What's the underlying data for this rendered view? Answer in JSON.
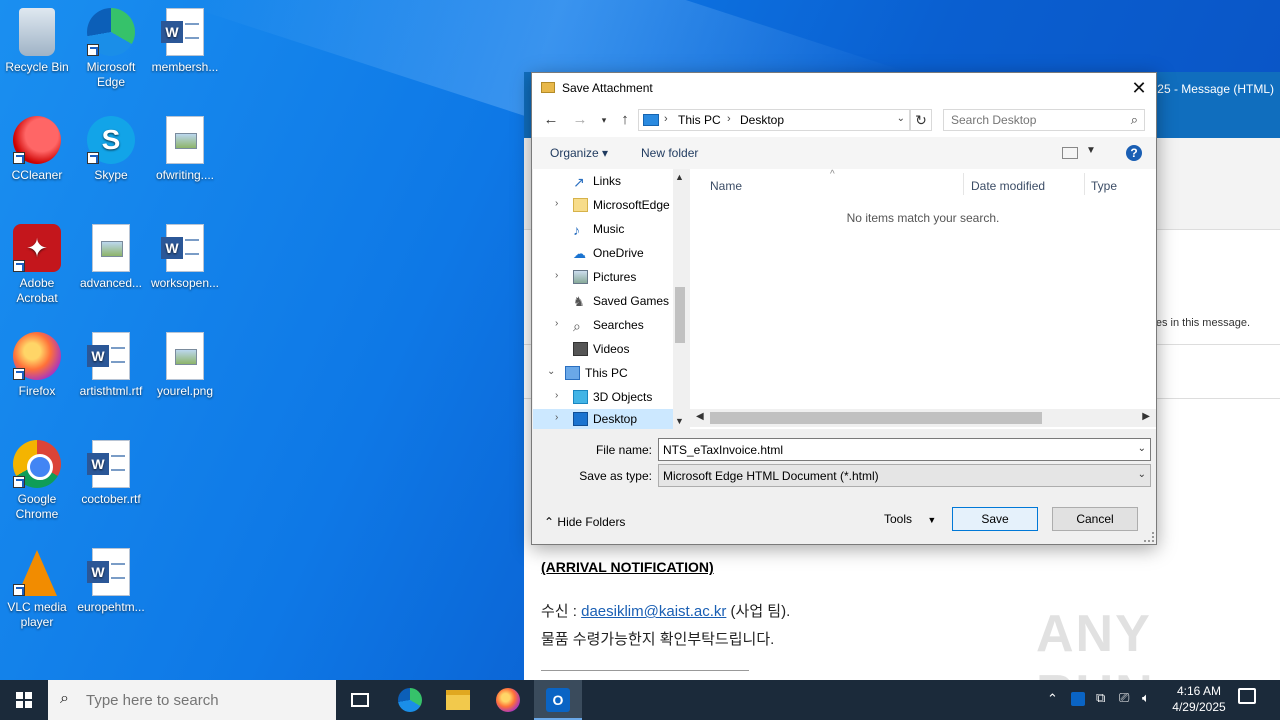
{
  "desktop": {
    "icons": [
      {
        "label": "Recycle Bin"
      },
      {
        "label": "Microsoft Edge"
      },
      {
        "label": "membersh..."
      },
      {
        "label": "CCleaner"
      },
      {
        "label": "Skype"
      },
      {
        "label": "ofwriting...."
      },
      {
        "label": "Adobe Acrobat"
      },
      {
        "label": "advanced..."
      },
      {
        "label": "worksopen..."
      },
      {
        "label": "Firefox"
      },
      {
        "label": "artisthtml.rtf"
      },
      {
        "label": "yourel.png"
      },
      {
        "label": "Google Chrome"
      },
      {
        "label": "coctober.rtf"
      },
      {
        "label": "VLC media player"
      },
      {
        "label": "europehtm..."
      }
    ]
  },
  "message_window": {
    "title_suffix": "25  -  Message (HTML)",
    "info_text": "es in this message.",
    "arrival": "(ARRIVAL NOTIFICATION)",
    "recv_prefix": "수신 : ",
    "recv_email": "daesiklim@kaist.ac.kr",
    "recv_suffix": " (사업 팀).",
    "confirm_text": "물품 수령가능한지 확인부탁드립니다.",
    "watermark": "ANY RUN"
  },
  "dialog": {
    "title": "Save Attachment",
    "address": {
      "root": "This PC",
      "folder": "Desktop"
    },
    "search_placeholder": "Search Desktop",
    "organize": "Organize ▾",
    "new_folder": "New folder",
    "help": "?",
    "tree": [
      {
        "label": "Links",
        "expandable": false
      },
      {
        "label": "MicrosoftEdge",
        "expandable": true
      },
      {
        "label": "Music",
        "expandable": false
      },
      {
        "label": "OneDrive",
        "expandable": false
      },
      {
        "label": "Pictures",
        "expandable": true
      },
      {
        "label": "Saved Games",
        "expandable": false
      },
      {
        "label": "Searches",
        "expandable": true
      },
      {
        "label": "Videos",
        "expandable": false
      },
      {
        "label": "This PC",
        "expandable": true
      },
      {
        "label": "3D Objects",
        "expandable": true
      },
      {
        "label": "Desktop",
        "expandable": true,
        "selected": true
      }
    ],
    "columns": [
      "Name",
      "Date modified",
      "Type"
    ],
    "empty_text": "No items match your search.",
    "file_name_label": "File name:",
    "file_name_value": "NTS_eTaxInvoice.html",
    "save_type_label": "Save as type:",
    "save_type_value": "Microsoft Edge HTML Document (*.html)",
    "hide_folders": "Hide Folders",
    "tools": "Tools",
    "save": "Save",
    "cancel": "Cancel"
  },
  "taskbar": {
    "search_placeholder": "Type here to search",
    "time": "4:16 AM",
    "date": "4/29/2025"
  }
}
